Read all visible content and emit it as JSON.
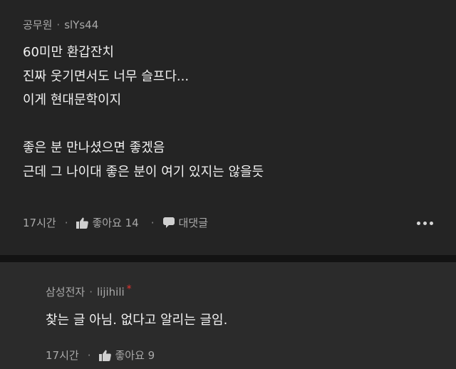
{
  "comment1": {
    "author": "공무원",
    "separator": "·",
    "user_id": "slYs44",
    "lines": [
      "60미만 환갑잔치",
      "진짜 웃기면서도 너무 슬프다...",
      "이게 현대문학이지",
      "",
      "좋은 분 만나셨으면 좋겠음",
      "근데 그 나이대 좋은 분이 여기 있지는 않을듯"
    ],
    "time": "17시간",
    "like_label": "좋아요 14",
    "reply_label": "대댓글",
    "icons": {
      "like": "thumbs-up-icon",
      "reply": "speech-bubble-icon",
      "more": "more-dots-icon"
    }
  },
  "comment2": {
    "author": "삼성전자",
    "separator": "·",
    "user_id": "lijihili",
    "badge": "*",
    "lines": [
      "찾는 글 아님. 없다고 알리는 글임."
    ],
    "time": "17시간",
    "like_label": "좋아요 9",
    "icons": {
      "like": "thumbs-up-icon"
    }
  },
  "colors": {
    "background": "#242424",
    "reply_background": "#2b2b2b",
    "badge": "#e5342f"
  }
}
